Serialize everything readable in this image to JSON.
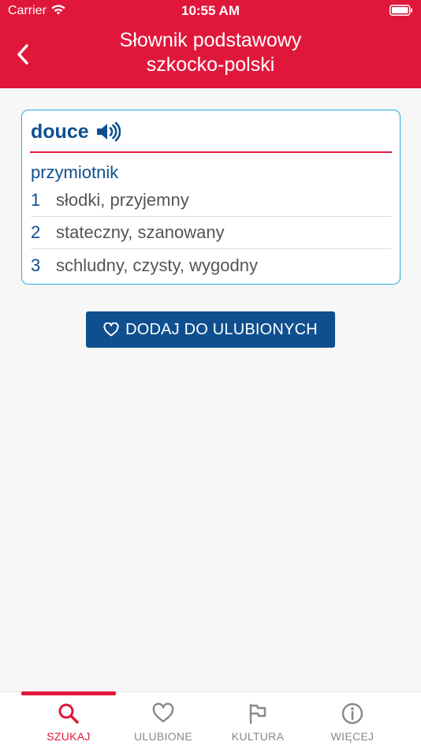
{
  "status_bar": {
    "carrier": "Carrier",
    "time": "10:55 AM"
  },
  "header": {
    "title_line1": "Słownik podstawowy",
    "title_line2": "szkocko-polski",
    "back_icon": "chevron-left-icon"
  },
  "entry": {
    "headword": "douce",
    "audio_icon": "speaker-icon",
    "part_of_speech": "przymiotnik",
    "senses": [
      {
        "number": "1",
        "text": "słodki, przyjemny"
      },
      {
        "number": "2",
        "text": "stateczny, szanowany"
      },
      {
        "number": "3",
        "text": "schludny, czysty, wygodny"
      }
    ]
  },
  "favorite_button": {
    "label": "DODAJ DO ULUBIONYCH",
    "icon": "heart-outline-icon"
  },
  "tabbar": {
    "active": "szukaj",
    "tabs": [
      {
        "id": "szukaj",
        "label": "SZUKAJ",
        "icon": "search-icon"
      },
      {
        "id": "ulubione",
        "label": "ULUBIONE",
        "icon": "heart-icon"
      },
      {
        "id": "kultura",
        "label": "KULTURA",
        "icon": "flag-icon"
      },
      {
        "id": "wiecej",
        "label": "WIĘCEJ",
        "icon": "info-icon"
      }
    ]
  },
  "colors": {
    "brand_red": "#e0173b",
    "brand_blue": "#0f4f8f",
    "card_border": "#2ca8d8",
    "inactive_gray": "#888888"
  }
}
